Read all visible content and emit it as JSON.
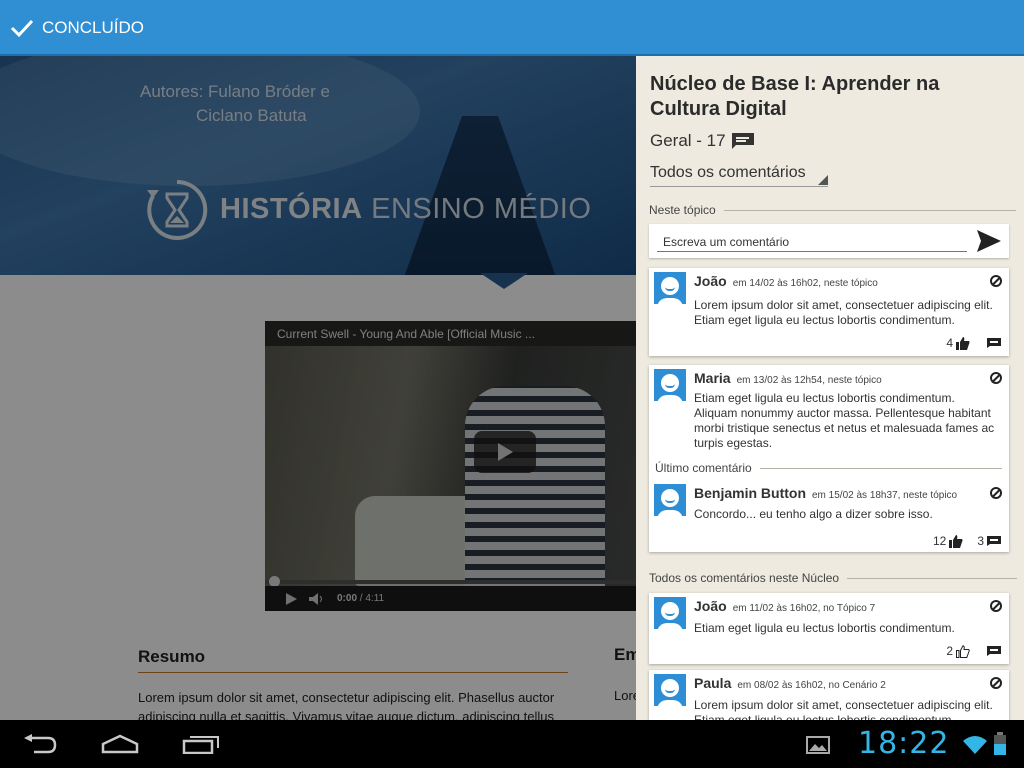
{
  "topbar": {
    "done_label": "CONCLUÍDO"
  },
  "banner": {
    "authors_line1": "Autores: Fulano Bróder e",
    "authors_line2": "Ciclano Batuta",
    "subject_bold": "HISTÓRIA",
    "subject_rest": " ENSINO MÉDIO"
  },
  "video": {
    "title": "Current Swell - Young And Able [Official Music ...",
    "time_current": "0:00",
    "time_total": "/ 4:11"
  },
  "article": {
    "resumo_heading": "Resumo",
    "resumo_text": "Lorem ipsum dolor sit amet, consectetur adipiscing elit. Phasellus auctor adipiscing nulla et sagittis. Vivamus vitae augue dictum, adipiscing tellus",
    "em_heading": "Em",
    "right_text": "Lorem scin"
  },
  "panel": {
    "title": "Núcleo de Base I: Aprender na Cultura Digital",
    "geral": "Geral - 17",
    "filter": "Todos os comentários",
    "section_topic": "Neste tópico",
    "write_placeholder": "Escreva um comentário",
    "last_comment_label": "Último comentário",
    "section_all": "Todos os comentários neste Núcleo",
    "comments": [
      {
        "name": "João",
        "meta": "em 14/02 às 16h02, neste tópico",
        "text": "Lorem ipsum dolor sit amet, consectetuer adipiscing elit. Etiam eget ligula eu lectus lobortis condimentum.",
        "likes": "4",
        "replies": ""
      },
      {
        "name": "Maria",
        "meta": "em 13/02 às 12h54, neste tópico",
        "text": "Etiam eget ligula eu lectus lobortis condimentum. Aliquam nonummy auctor massa. Pellentesque habitant morbi tristique senectus et netus et malesuada fames ac turpis egestas."
      },
      {
        "name": "Benjamin Button",
        "meta": "em 15/02 às 18h37, neste tópico",
        "text": "Concordo... eu tenho algo a dizer sobre isso.",
        "likes": "12",
        "replies": "3"
      },
      {
        "name": "João",
        "meta": "em 11/02 às 16h02, no Tópico 7",
        "text": "Etiam eget ligula eu lectus lobortis condimentum.",
        "likes": "2",
        "replies": ""
      },
      {
        "name": "Paula",
        "meta": "em 08/02 às 16h02, no Cenário 2",
        "text": "Lorem ipsum dolor sit amet, consectetuer adipiscing elit. Etiam eget ligula eu lectus lobortis condimentum."
      }
    ]
  },
  "statusbar": {
    "time": "18:22"
  },
  "colors": {
    "accent": "#2f8fd2",
    "panel_bg": "#eeeae0",
    "clock": "#33b5e5"
  }
}
